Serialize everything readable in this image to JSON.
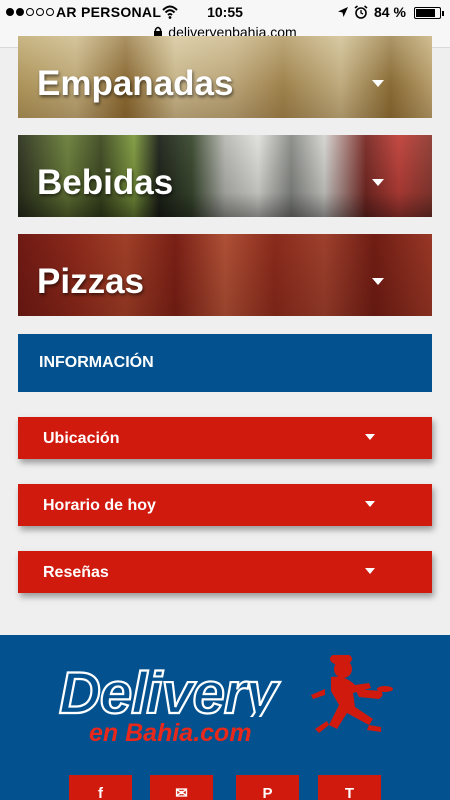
{
  "status_bar": {
    "carrier": "AR PERSONAL",
    "time": "10:55",
    "battery": "84 %",
    "battery_level": 0.84,
    "signal_bars": 2,
    "url": "deliveryenbahia.com"
  },
  "categories": [
    {
      "label": "Empanadas"
    },
    {
      "label": "Bebidas"
    },
    {
      "label": "Pizzas"
    }
  ],
  "info": {
    "title": "INFORMACIÓN",
    "items": [
      {
        "label": "Ubicación"
      },
      {
        "label": "Horario de hoy"
      },
      {
        "label": "Reseñas"
      }
    ]
  },
  "footer": {
    "logo_top": "Delivery",
    "logo_bottom": "en Bahia.com",
    "social": [
      {
        "label": "f",
        "icon": "facebook-icon"
      },
      {
        "label": "✉",
        "icon": "mail-icon"
      },
      {
        "label": "P",
        "icon": "pinterest-icon"
      },
      {
        "label": "T",
        "icon": "twitter-icon"
      }
    ]
  },
  "colors": {
    "brand_blue": "#03528f",
    "brand_red": "#d11a0e",
    "page_bg": "#efefef"
  }
}
